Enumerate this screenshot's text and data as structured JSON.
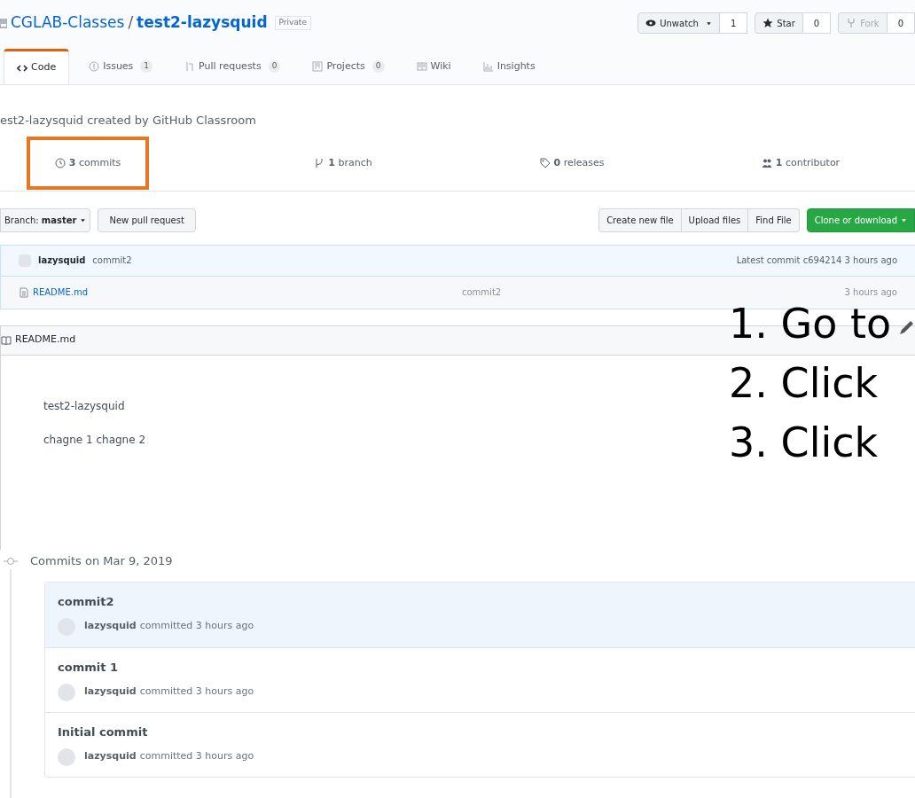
{
  "repo": {
    "owner": "CGLAB-Classes",
    "separator": "/",
    "name": "test2-lazysquid",
    "badge": "Private"
  },
  "actions": [
    {
      "kind": "watch",
      "label": "Unwatch",
      "count": "1",
      "disabled": false
    },
    {
      "kind": "star",
      "label": "Star",
      "count": "0",
      "disabled": false
    },
    {
      "kind": "fork",
      "label": "Fork",
      "count": "0",
      "disabled": true
    }
  ],
  "tabs": [
    {
      "kind": "code",
      "label": "Code",
      "selected": true
    },
    {
      "kind": "issue",
      "label": "Issues",
      "count": "1",
      "selected": false
    },
    {
      "kind": "pr",
      "label": "Pull requests",
      "count": "0",
      "selected": false
    },
    {
      "kind": "project",
      "label": "Projects",
      "count": "0",
      "selected": false
    },
    {
      "kind": "wiki",
      "label": "Wiki",
      "selected": false
    },
    {
      "kind": "graph",
      "label": "Insights",
      "selected": false
    }
  ],
  "description": "est2-lazysquid created by GitHub Classroom",
  "summary": [
    {
      "kind": "commits",
      "text": "**3** commits",
      "highlighted": true
    },
    {
      "kind": "branch",
      "text": "**1** branch",
      "highlighted": false
    },
    {
      "kind": "tag",
      "text": "**0** releases",
      "highlighted": false
    },
    {
      "kind": "people",
      "text": "**1** contributor",
      "highlighted": false
    }
  ],
  "branch_select": "Branch: **master**",
  "new_pull_request": "New pull request",
  "file_actions": [
    "Create new file",
    "Upload files",
    "Find File"
  ],
  "clone": "Clone or download",
  "latest_commit": {
    "author": "lazysquid",
    "message": "commit2",
    "info": "Latest commit c694214 3 hours ago"
  },
  "files": [
    {
      "name": "README.md",
      "message": "commit2",
      "age": "3 hours ago"
    }
  ],
  "readme": {
    "title": "README.md",
    "lines": [
      "test2-lazysquid",
      "chagne 1 chagne 2"
    ]
  },
  "steps": [
    "1. Go to",
    "2. Click",
    "3. Click"
  ],
  "commit_group": {
    "date": "Commits on Mar 9, 2019",
    "commits": [
      {
        "title": "commit2",
        "author": "lazysquid",
        "info": "committed 3 hours ago",
        "highlighted": true
      },
      {
        "title": "commit 1",
        "author": "lazysquid",
        "info": "committed 3 hours ago",
        "highlighted": false
      },
      {
        "title": "Initial commit",
        "author": "lazysquid",
        "info": "committed 3 hours ago",
        "highlighted": false
      }
    ]
  }
}
